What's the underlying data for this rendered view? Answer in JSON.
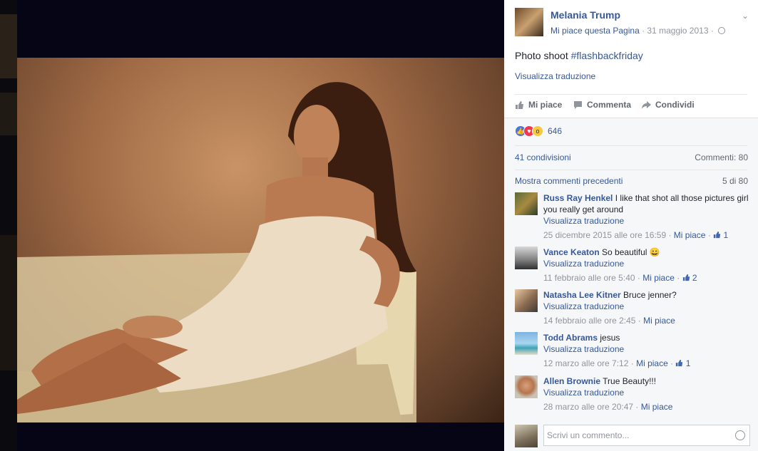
{
  "post": {
    "page_name": "Melania Trump",
    "like_page": "Mi piace questa Pagina",
    "date_sep": " · ",
    "date": "31 maggio 2013",
    "text_prefix": "Photo shoot ",
    "hashtag": "#flashbackfriday",
    "translate": "Visualizza traduzione"
  },
  "actions": {
    "like": "Mi piace",
    "comment": "Commenta",
    "share": "Condividi"
  },
  "stats": {
    "reactions_count": "646",
    "shares": "41 condivisioni",
    "comments": "Commenti: 80",
    "more_comments": "Mostra commenti precedenti",
    "pager": "5 di 80"
  },
  "comments": [
    {
      "author": "Russ Ray Henkel",
      "text": "I like that shot all those pictures girl you really get around",
      "translate": "Visualizza traduzione",
      "time": "25 dicembre 2015 alle ore 16:59",
      "like": "Mi piace",
      "likes": "1"
    },
    {
      "author": "Vance Keaton",
      "text": "So beautiful",
      "emoji": "😄",
      "translate": "Visualizza traduzione",
      "time": "11 febbraio alle ore 5:40",
      "like": "Mi piace",
      "likes": "2"
    },
    {
      "author": "Natasha Lee Kitner",
      "text": "Bruce jenner?",
      "translate": "Visualizza traduzione",
      "time": "14 febbraio alle ore 2:45",
      "like": "Mi piace"
    },
    {
      "author": "Todd Abrams",
      "text": "jesus",
      "translate": "Visualizza traduzione",
      "time": "12 marzo alle ore 7:12",
      "like": "Mi piace",
      "likes": "1"
    },
    {
      "author": "Allen Brownie",
      "text": "True Beauty!!!",
      "translate": "Visualizza traduzione",
      "time": "28 marzo alle ore 20:47",
      "like": "Mi piace"
    }
  ],
  "composer": {
    "placeholder": "Scrivi un commento..."
  },
  "colors": {
    "link": "#365899",
    "muted": "#90949c",
    "photo_bg": "#050515"
  }
}
